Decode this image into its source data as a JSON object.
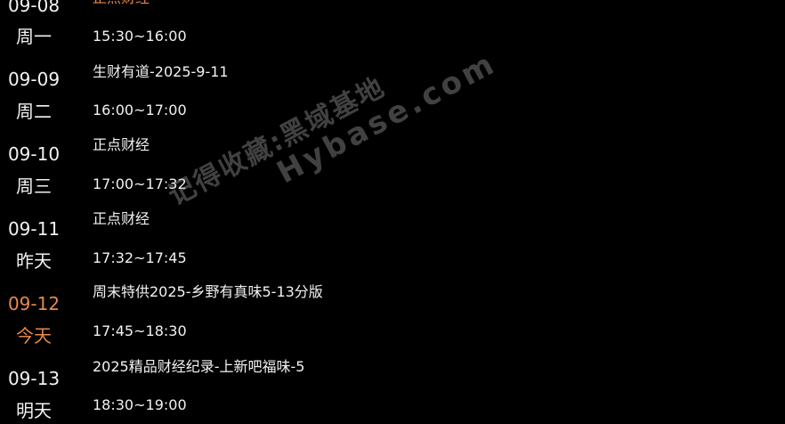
{
  "dates": [
    {
      "date": "09-08",
      "weekday": "周一",
      "active": false
    },
    {
      "date": "09-09",
      "weekday": "周二",
      "active": false
    },
    {
      "date": "09-10",
      "weekday": "周三",
      "active": false
    },
    {
      "date": "09-11",
      "weekday": "昨天",
      "active": false
    },
    {
      "date": "09-12",
      "weekday": "今天",
      "active": true
    },
    {
      "date": "09-13",
      "weekday": "明天",
      "active": false
    }
  ],
  "programs": [
    {
      "title": "正点财经",
      "active": true
    },
    {
      "time": "15:30~16:00",
      "title": "生财有道-2025-9-11"
    },
    {
      "time": "16:00~17:00",
      "title": "正点财经"
    },
    {
      "time": "17:00~17:32",
      "title": "正点财经"
    },
    {
      "time": "17:32~17:45",
      "title": "周末特供2025-乡野有真味5-13分版"
    },
    {
      "time": "17:45~18:30",
      "title": "2025精品财经纪录-上新吧福味-5"
    },
    {
      "time": "18:30~19:00"
    }
  ],
  "watermark": {
    "line1": "记得收藏:黑域基地",
    "line2": "Hybase.com"
  },
  "colors": {
    "background": "#000000",
    "text": "#f2f2f2",
    "active": "#e8884a"
  }
}
